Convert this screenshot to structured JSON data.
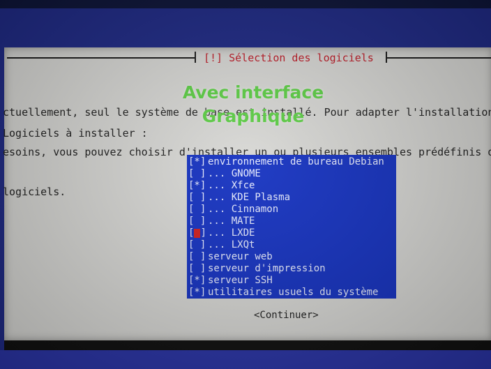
{
  "dialog": {
    "title": "[!] Sélection des logiciels",
    "intro_lines": [
      "ctuellement, seul le système de base est installé. Pour adapter l'installation",
      "esoins, vous pouvez choisir d'installer un ou plusieurs ensembles prédéfinis d",
      "logiciels."
    ],
    "section_label": "Logiciels à installer :",
    "continue_label": "<Continuer>",
    "list_background": "#1633c2",
    "title_color": "#c01c28"
  },
  "overlay": {
    "line1": "Avec interface",
    "line2": "Graphique",
    "color": "#5fd147"
  },
  "software": [
    {
      "checked": "[*]",
      "label": "environnement de bureau Debian"
    },
    {
      "checked": "[ ]",
      "label": "... GNOME"
    },
    {
      "checked": "[*]",
      "label": "... Xfce"
    },
    {
      "checked": "[ ]",
      "label": "... KDE Plasma"
    },
    {
      "checked": "[ ]",
      "label": "... Cinnamon"
    },
    {
      "checked": "[ ]",
      "label": "... MATE"
    },
    {
      "checked": "[ ]",
      "label": "... LXDE",
      "focused": true
    },
    {
      "checked": "[ ]",
      "label": "... LXQt"
    },
    {
      "checked": "[ ]",
      "label": "serveur web"
    },
    {
      "checked": "[ ]",
      "label": "serveur d'impression"
    },
    {
      "checked": "[*]",
      "label": "serveur SSH"
    },
    {
      "checked": "[*]",
      "label": "utilitaires usuels du système"
    }
  ]
}
